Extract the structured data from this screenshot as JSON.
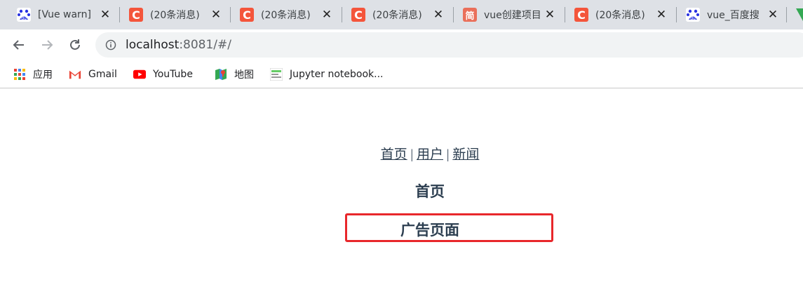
{
  "browser": {
    "tabs": [
      {
        "title": "[Vue warn]",
        "favicon": "baidu-paw-icon"
      },
      {
        "title": "(20条消息)",
        "favicon": "csdn-icon"
      },
      {
        "title": "(20条消息)",
        "favicon": "csdn-icon"
      },
      {
        "title": "(20条消息)",
        "favicon": "csdn-icon"
      },
      {
        "title": "vue创建项目",
        "favicon": "jianshu-icon"
      },
      {
        "title": "(20条消息)",
        "favicon": "csdn-icon"
      },
      {
        "title": "vue_百度搜",
        "favicon": "baidu-paw-icon"
      }
    ],
    "close_glyph": "✕",
    "address": {
      "host": "localhost",
      "rest": ":8081/#/"
    },
    "bookmarks": [
      {
        "label": "应用",
        "icon": "apps-grid-icon"
      },
      {
        "label": "Gmail",
        "icon": "gmail-icon"
      },
      {
        "label": "YouTube",
        "icon": "youtube-icon"
      },
      {
        "label": "地图",
        "icon": "maps-icon"
      },
      {
        "label": "Jupyter notebook...",
        "icon": "jupyter-icon"
      }
    ],
    "csdn_glyph": "C",
    "jianshu_glyph": "简"
  },
  "page": {
    "nav": {
      "home": "首页",
      "sep": "|",
      "user": "用户",
      "news": "新闻"
    },
    "heading": "首页",
    "ad_heading": "广告页面"
  },
  "colors": {
    "text": "#2c3e50",
    "highlight_border": "#e8272b",
    "tabstrip_bg": "#dee1e6"
  }
}
